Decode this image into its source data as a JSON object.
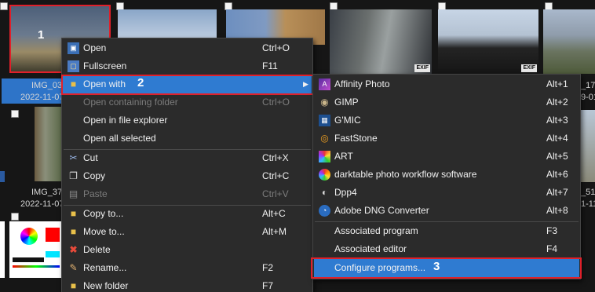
{
  "thumbnails": {
    "row1": [
      {
        "caption": "IMG_03",
        "date": "2022-11-07",
        "badge_number": "1"
      },
      {
        "caption": "",
        "date": ""
      },
      {
        "caption": "",
        "date": ""
      },
      {
        "caption": "",
        "date": "",
        "exif": "EXIF"
      },
      {
        "caption": "",
        "date": "",
        "exif": "EXIF"
      },
      {
        "caption": "_17",
        "date": "9-01"
      }
    ],
    "row2": [
      {
        "caption": "IMG_37",
        "date": "2022-11-07"
      },
      {
        "caption": "_51",
        "date": "1-11"
      }
    ]
  },
  "context_menu": {
    "items": [
      {
        "label": "Open",
        "shortcut": "Ctrl+O",
        "icon": "image-icon",
        "disabled": false
      },
      {
        "label": "Fullscreen",
        "shortcut": "F11",
        "icon": "fullscreen-icon",
        "disabled": false
      },
      {
        "label": "Open with",
        "shortcut": "",
        "icon": "folder-icon",
        "disabled": false,
        "highlighted": true,
        "badge_number": "2"
      },
      {
        "label": "Open containing folder",
        "shortcut": "Ctrl+O",
        "icon": "",
        "disabled": true
      },
      {
        "label": "Open in file explorer",
        "shortcut": "",
        "icon": "",
        "disabled": false
      },
      {
        "label": "Open all selected",
        "shortcut": "",
        "icon": "",
        "disabled": false
      },
      {
        "label": "Cut",
        "shortcut": "Ctrl+X",
        "icon": "scissors-icon",
        "disabled": false
      },
      {
        "label": "Copy",
        "shortcut": "Ctrl+C",
        "icon": "copy-icon",
        "disabled": false
      },
      {
        "label": "Paste",
        "shortcut": "Ctrl+V",
        "icon": "paste-icon",
        "disabled": true
      },
      {
        "label": "Copy to...",
        "shortcut": "Alt+C",
        "icon": "copy-to-folder-icon",
        "disabled": false
      },
      {
        "label": "Move to...",
        "shortcut": "Alt+M",
        "icon": "move-to-folder-icon",
        "disabled": false
      },
      {
        "label": "Delete",
        "shortcut": "",
        "icon": "delete-icon",
        "disabled": false
      },
      {
        "label": "Rename...",
        "shortcut": "F2",
        "icon": "rename-icon",
        "disabled": false
      },
      {
        "label": "New folder",
        "shortcut": "F7",
        "icon": "new-folder-icon",
        "disabled": false
      }
    ]
  },
  "submenu": {
    "items": [
      {
        "label": "Affinity Photo",
        "shortcut": "Alt+1",
        "icon": "affinity-photo-icon"
      },
      {
        "label": "GIMP",
        "shortcut": "Alt+2",
        "icon": "gimp-icon"
      },
      {
        "label": "G'MIC",
        "shortcut": "Alt+3",
        "icon": "gmic-icon"
      },
      {
        "label": "FastStone",
        "shortcut": "Alt+4",
        "icon": "faststone-icon"
      },
      {
        "label": "ART",
        "shortcut": "Alt+5",
        "icon": "art-icon"
      },
      {
        "label": "darktable photo workflow software",
        "shortcut": "Alt+6",
        "icon": "darktable-icon"
      },
      {
        "label": "Dpp4",
        "shortcut": "Alt+7",
        "icon": "dpp4-icon"
      },
      {
        "label": "Adobe DNG Converter",
        "shortcut": "Alt+8",
        "icon": "adobe-dng-icon"
      },
      {
        "label": "Associated program",
        "shortcut": "F3",
        "icon": ""
      },
      {
        "label": "Associated editor",
        "shortcut": "F4",
        "icon": ""
      },
      {
        "label": "Configure programs...",
        "shortcut": "",
        "icon": "",
        "highlighted": true,
        "badge_number": "3"
      }
    ]
  },
  "colors": {
    "highlight": "#2f7bd1",
    "annotation_red": "#e0202a",
    "menu_bg": "#2b2b2b"
  }
}
